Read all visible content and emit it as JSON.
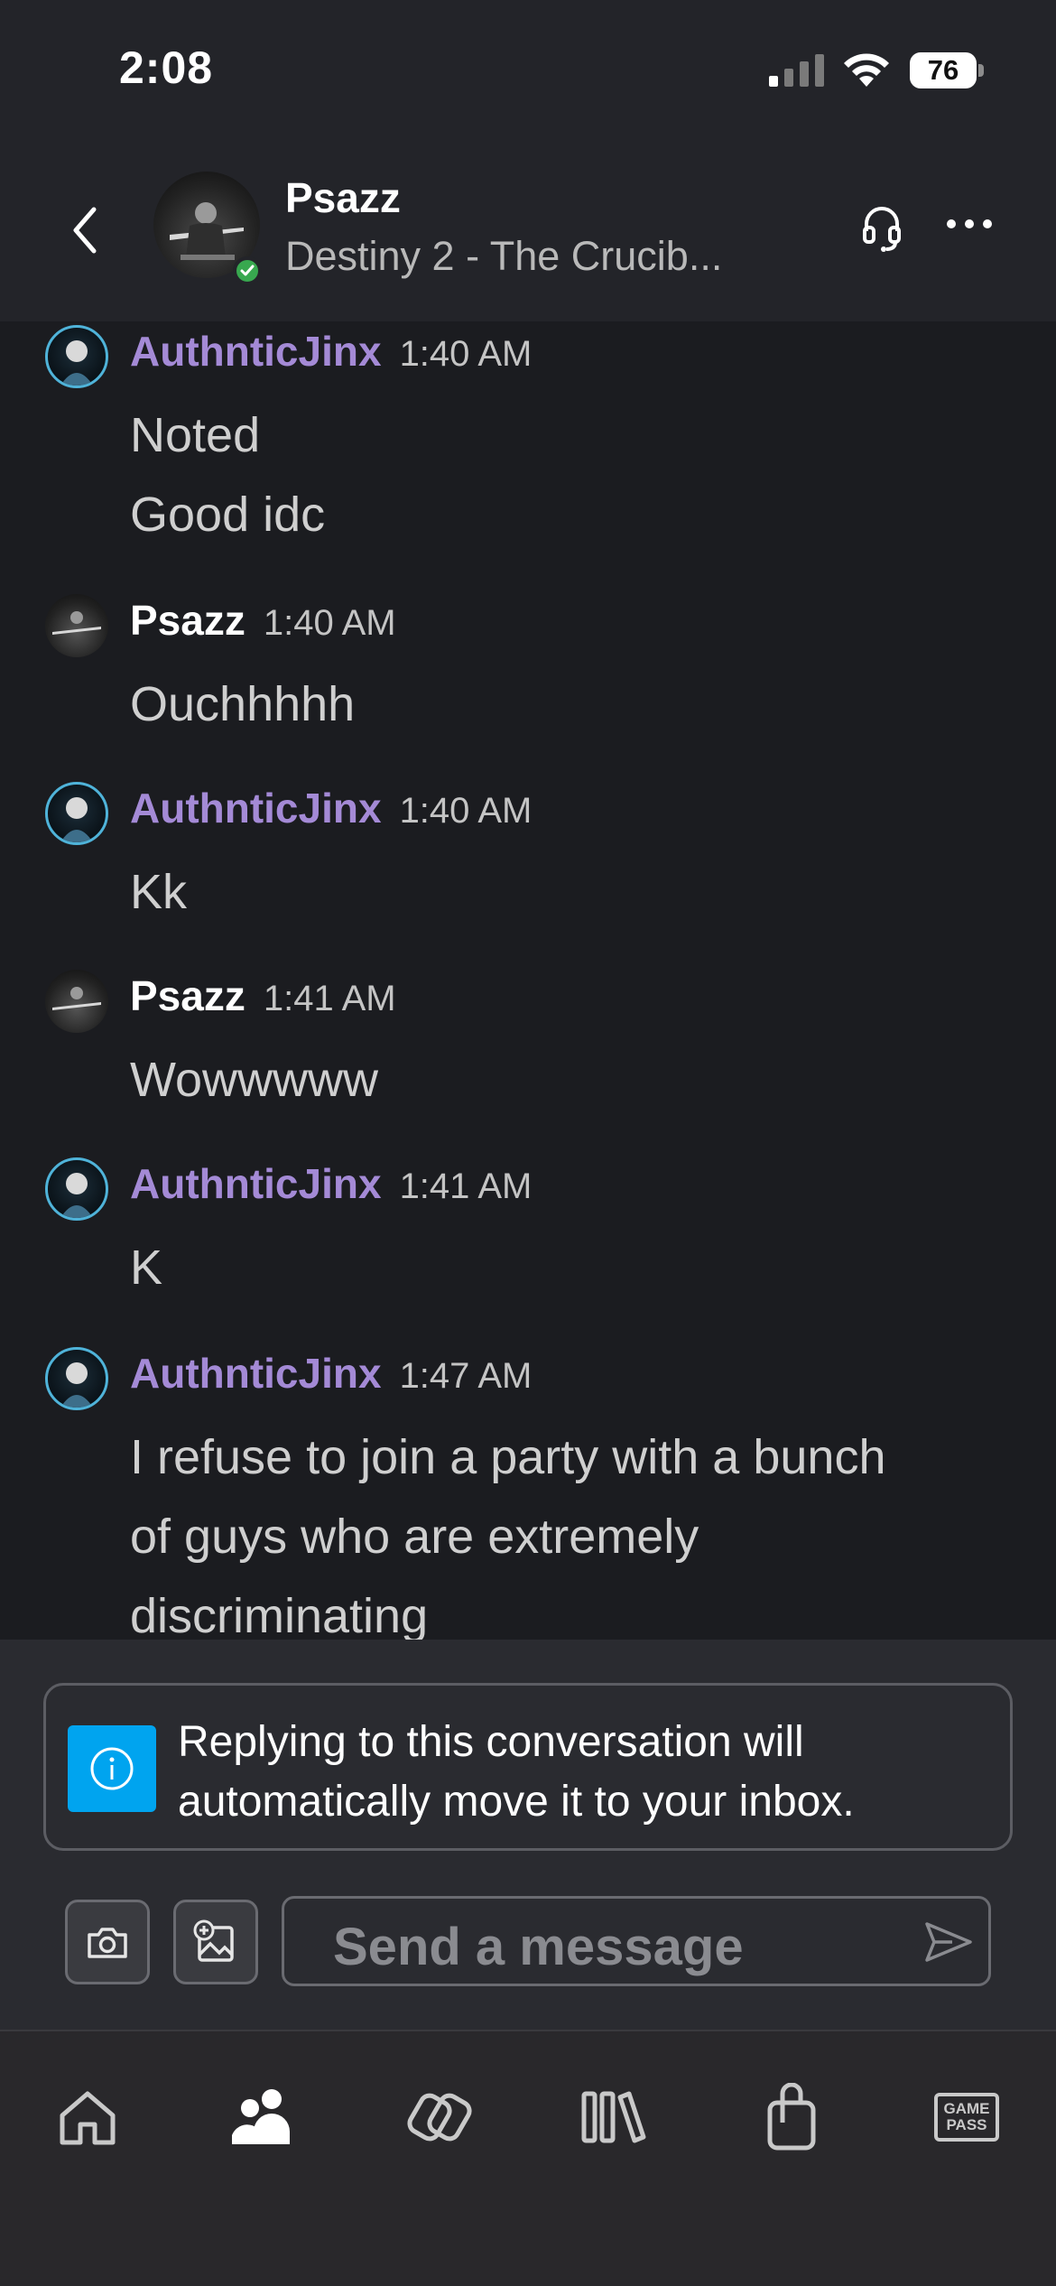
{
  "status_bar": {
    "time": "2:08",
    "battery": "76",
    "icons": [
      "cellular-signal-icon",
      "wifi-icon",
      "battery-icon"
    ]
  },
  "header": {
    "back_icon": "chevron-left-icon",
    "contact_name": "Psazz",
    "contact_status": "Destiny 2 - The Crucib...",
    "presence": "online",
    "headset_icon": "headset-icon",
    "more_icon": "more-horizontal-icon"
  },
  "messages": [
    {
      "author": "AuthnticJinx",
      "time": "1:40 AM",
      "lines": [
        "Noted",
        "Good idc"
      ]
    },
    {
      "author": "Psazz",
      "time": "1:40 AM",
      "lines": [
        "Ouchhhhh"
      ]
    },
    {
      "author": "AuthnticJinx",
      "time": "1:40 AM",
      "lines": [
        "Kk"
      ]
    },
    {
      "author": "Psazz",
      "time": "1:41 AM",
      "lines": [
        "Wowwwww"
      ]
    },
    {
      "author": "AuthnticJinx",
      "time": "1:41 AM",
      "lines": [
        "K"
      ]
    },
    {
      "author": "AuthnticJinx",
      "time": "1:47 AM",
      "lines": [
        "I refuse to join a party with a bunch",
        "of guys who are extremely",
        "discriminating"
      ]
    }
  ],
  "notice": {
    "line1": "Replying to this conversation will",
    "line2": "automatically move it to your inbox.",
    "icon": "info-icon"
  },
  "composer": {
    "placeholder": "Send a message",
    "camera_icon": "camera-icon",
    "image_icon": "add-image-icon",
    "send_icon": "send-icon"
  },
  "tabbar": {
    "tabs": [
      "home-icon",
      "friends-icon",
      "social-icon",
      "library-icon",
      "store-icon",
      "game-pass-icon"
    ],
    "game_pass_line1": "GAME",
    "game_pass_line2": "PASS"
  },
  "colors": {
    "name_jinx": "#a48ad6",
    "name_psazz": "#ffffff",
    "presence_green": "#38a84f",
    "info_blue": "#00a4ef"
  }
}
